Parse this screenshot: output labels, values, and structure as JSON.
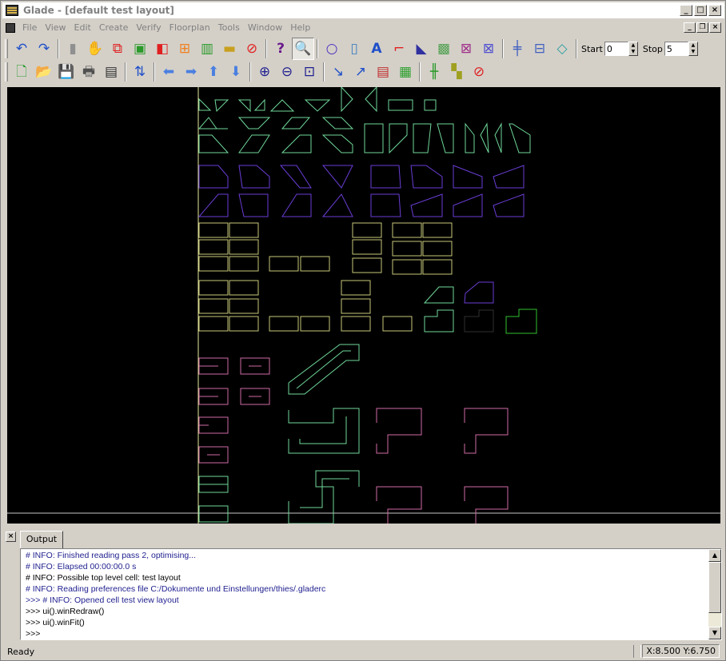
{
  "window": {
    "title": "Glade - [default test layout]"
  },
  "menu": [
    "File",
    "View",
    "Edit",
    "Create",
    "Verify",
    "Floorplan",
    "Tools",
    "Window",
    "Help"
  ],
  "toolbar": {
    "start_label": "Start",
    "start_value": "0",
    "stop_label": "Stop",
    "stop_value": "5"
  },
  "output": {
    "tab_label": "Output",
    "lines": [
      "# INFO: Finished reading pass 2, optimising...",
      "# INFO: Elapsed 00:00:00.0 s",
      "# INFO: Possible top level cell: test layout",
      "# INFO: Reading preferences file C:/Dokumente und Einstellungen/thies/.gladerc",
      ">>> # INFO: Opened cell test view layout",
      ">>> ui().winRedraw()",
      ">>> ui().winFit()",
      ">>>"
    ]
  },
  "status": {
    "text": "Ready",
    "coords": "X:8.500 Y:6.750"
  },
  "colors": {
    "green": "#6fd99a",
    "yellow": "#c8c87a",
    "purple": "#6a3dd6",
    "pink": "#d06aa6",
    "axis": "#e8e8a0"
  }
}
